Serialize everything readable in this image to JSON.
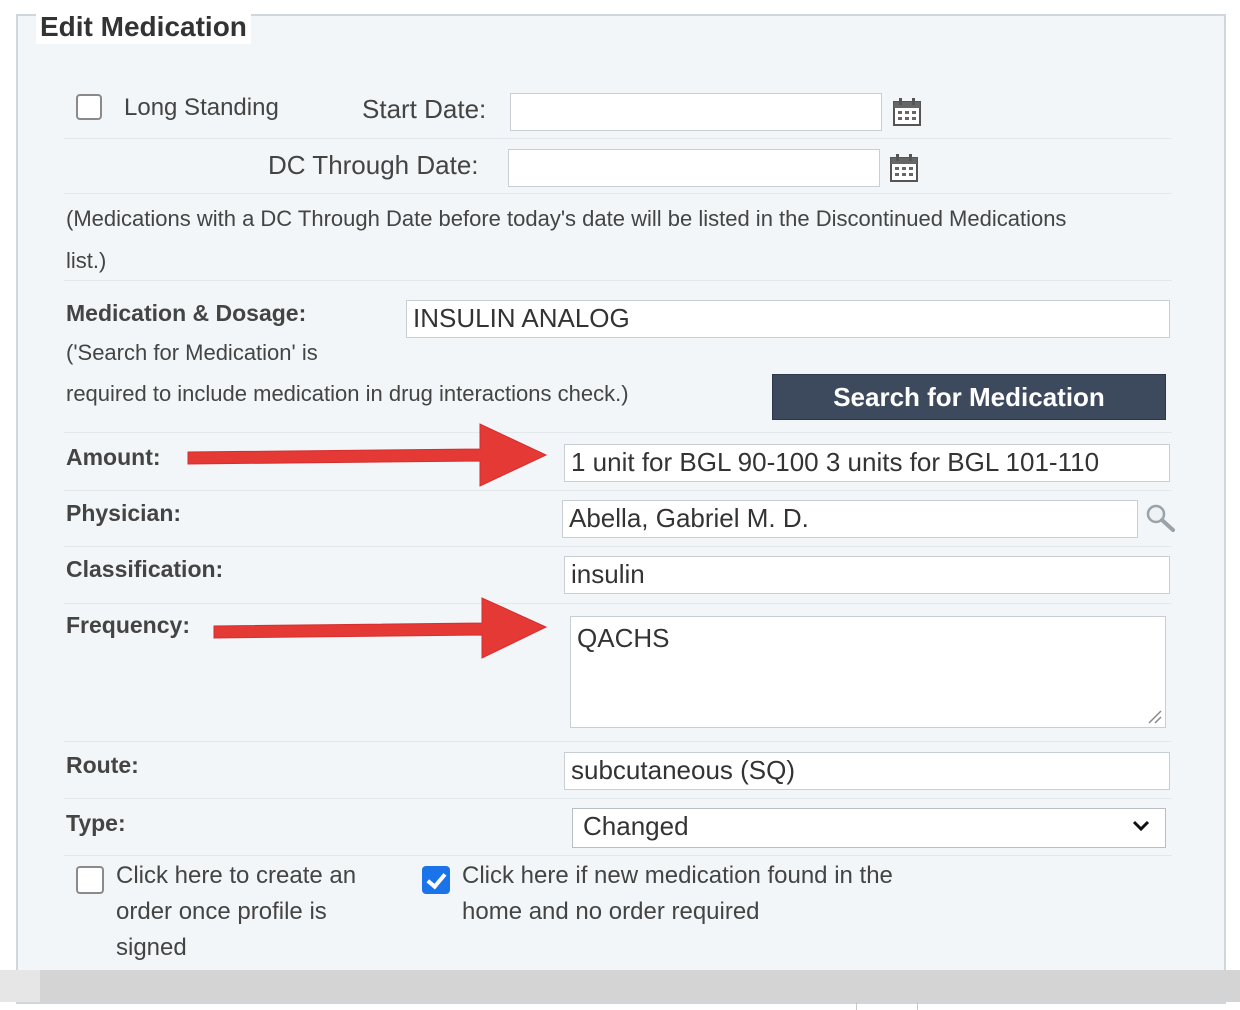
{
  "panel": {
    "title": "Edit Medication"
  },
  "dates": {
    "long_standing_label": "Long Standing",
    "long_standing_checked": false,
    "start_date_label": "Start Date:",
    "start_date_value": "",
    "dc_through_label": "DC Through Date:",
    "dc_through_value": "",
    "calendar_icon": "calendar-icon",
    "note_line1": "(Medications with a DC Through Date before today's date will be listed in the Discontinued Medications",
    "note_line2": "list.)"
  },
  "medication": {
    "label": "Medication & Dosage:",
    "hint_line1": "('Search for Medication' is",
    "hint_line2": "required to include medication in drug interactions check.)",
    "value": "INSULIN ANALOG",
    "search_button": "Search for Medication"
  },
  "amount": {
    "label": "Amount:",
    "value": "1 unit for BGL 90-100 3 units for BGL 101-110"
  },
  "physician": {
    "label": "Physician:",
    "value": "Abella, Gabriel M. D.",
    "lookup_icon": "magnifier-icon"
  },
  "classification": {
    "label": "Classification:",
    "value": "insulin"
  },
  "frequency": {
    "label": "Frequency:",
    "value": "QACHS"
  },
  "route": {
    "label": "Route:",
    "value": "subcutaneous (SQ)"
  },
  "type": {
    "label": "Type:",
    "value": "Changed"
  },
  "options": {
    "create_order_line1": "Click here to create an",
    "create_order_line2": "order once profile is",
    "create_order_line3": "signed",
    "create_order_checked": false,
    "no_order_line1": "Click here if new medication found in the",
    "no_order_line2": "home and no order required",
    "no_order_checked": true
  },
  "annotations": {
    "arrow_color": "#e53935"
  },
  "colors": {
    "button_bg": "#3d4a5d",
    "checkbox_checked": "#1a73e8",
    "panel_bg": "#f2f6f8"
  }
}
